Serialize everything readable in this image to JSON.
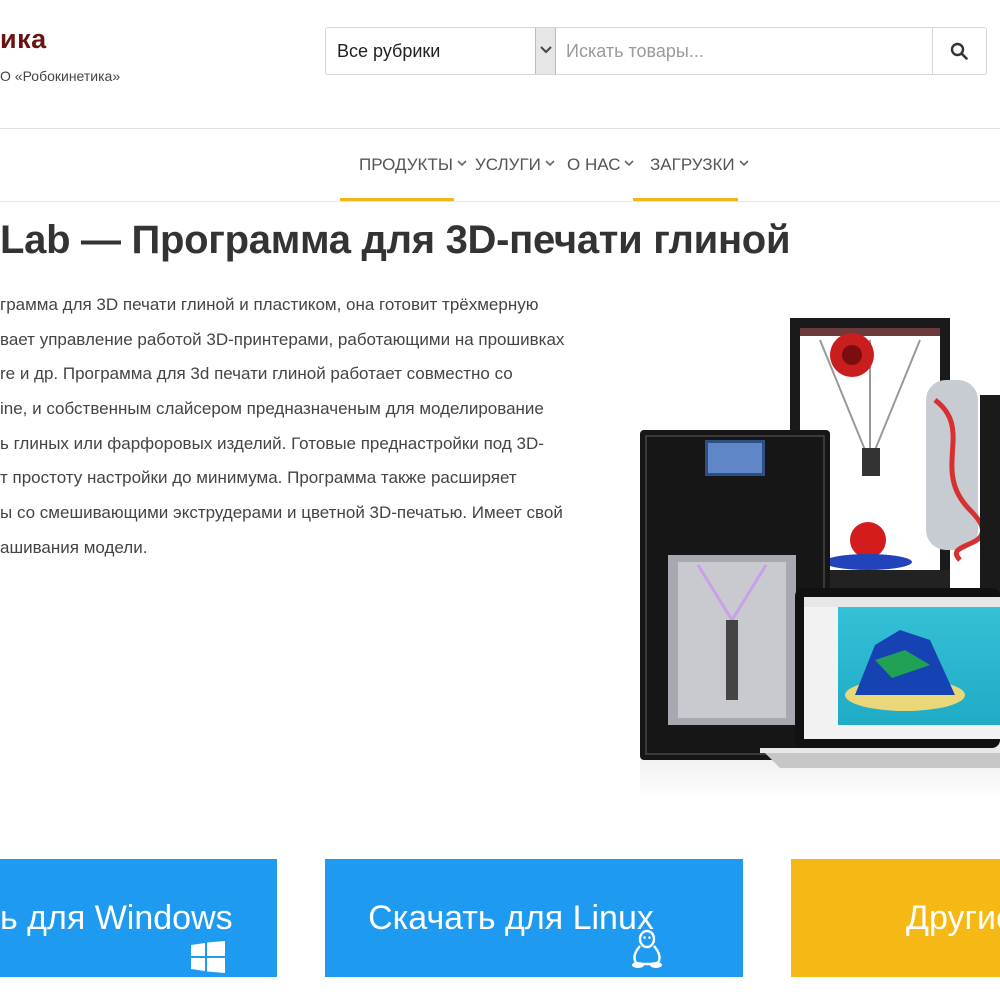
{
  "header": {
    "brand_name": "ика",
    "brand_sub": "О «Робокинетика»",
    "search": {
      "category": "Все рубрики",
      "placeholder": "Искать товары..."
    }
  },
  "nav": {
    "items": [
      {
        "label": "ПРОДУКТЫ",
        "active": true
      },
      {
        "label": "УСЛУГИ",
        "active": false
      },
      {
        "label": "О НАС",
        "active": false
      },
      {
        "label": "ЗАГРУЗКИ",
        "active": true
      }
    ]
  },
  "main": {
    "title": "Lab — Программа для 3D-печати глиной",
    "description_lines": [
      "грамма для 3D печати глиной и пластиком, она готовит трёхмерную",
      "вает управление работой 3D-принтерами, работающими на прошивках",
      "re и др. Программа для 3d печати глиной работает совместно со",
      "ine, и собственным слайсером предназначеным для моделирование",
      "ь глиных или фарфоровых изделий. Готовые преднастройки под 3D-",
      "т простоту настройки до минимума. Программа также расширяет",
      "ы со смешивающими экструдерами и цветной 3D-печатью. Имеет свой",
      "ашивания модели."
    ]
  },
  "downloads": {
    "windows_label": "ь для Windows",
    "linux_label": "Скачать для Linux",
    "other_label": "Другие"
  },
  "colors": {
    "brand": "#6b1212",
    "accent_underline": "#f3b51c",
    "button_blue": "#1e9bf0",
    "button_yellow": "#f5b815"
  },
  "icons": [
    "chevron-down-icon",
    "search-icon",
    "windows-icon",
    "linux-icon"
  ]
}
